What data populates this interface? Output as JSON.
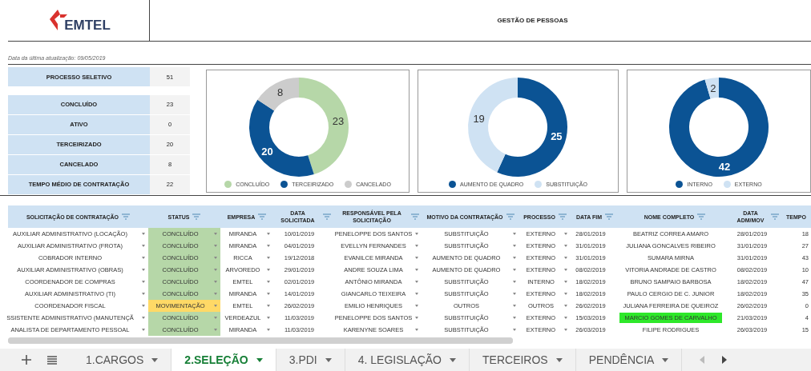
{
  "header": {
    "logo": "EMTEL",
    "title": "GESTÃO DE PESSOAS"
  },
  "last_update": "Data da última atualização: 09/05/2019",
  "summary": {
    "total": {
      "label": "PROCESSO SELETIVO",
      "value": "51"
    },
    "items": [
      {
        "label": "CONCLUÍDO",
        "value": "23"
      },
      {
        "label": "ATIVO",
        "value": "0"
      },
      {
        "label": "TERCEIRIZADO",
        "value": "20"
      },
      {
        "label": "CANCELADO",
        "value": "8"
      },
      {
        "label": "TEMPO MÉDIO DE CONTRATAÇÃO",
        "value": "22"
      }
    ]
  },
  "charts": [
    {
      "chart_data": {
        "type": "donut",
        "categories": [
          "CONCLUÍDO",
          "TERCEIRIZADO",
          "CANCELADO"
        ],
        "values": [
          23,
          20,
          8
        ],
        "colors": [
          "#b6d7a8",
          "#0b5394",
          "#cccccc"
        ],
        "data_labels": true,
        "legend": "bottom"
      }
    },
    {
      "chart_data": {
        "type": "donut",
        "categories": [
          "AUMENTO DE QUADRO",
          "SUBSTITUIÇÃO"
        ],
        "values": [
          25,
          19
        ],
        "colors": [
          "#0b5394",
          "#cfe2f3"
        ],
        "data_labels": true,
        "legend": "bottom"
      }
    },
    {
      "chart_data": {
        "type": "donut",
        "categories": [
          "INTERNO",
          "EXTERNO"
        ],
        "values": [
          42,
          2
        ],
        "colors": [
          "#0b5394",
          "#cfe2f3"
        ],
        "data_labels": true,
        "legend": "bottom"
      }
    }
  ],
  "table": {
    "columns": [
      {
        "label": "SOLICITAÇÃO DE CONTRATAÇÃO",
        "filter": true,
        "dropdown": true
      },
      {
        "label": "STATUS",
        "filter": true,
        "dropdown": true
      },
      {
        "label": "EMPRESA",
        "filter": true,
        "dropdown": true
      },
      {
        "label": "DATA SOLICITADA",
        "filter": true,
        "dropdown": false
      },
      {
        "label": "RESPONSÁVEL PELA SOLICITAÇÃO",
        "filter": true,
        "dropdown": true
      },
      {
        "label": "MOTIVO DA CONTRATAÇÃO",
        "filter": true,
        "dropdown": true
      },
      {
        "label": "PROCESSO",
        "filter": true,
        "dropdown": true
      },
      {
        "label": "DATA FIM",
        "filter": true,
        "dropdown": false
      },
      {
        "label": "NOME COMPLETO",
        "filter": true,
        "dropdown": false
      },
      {
        "label": "DATA ADM/MOV",
        "filter": true,
        "dropdown": false
      },
      {
        "label": "TEMPO",
        "filter": false,
        "dropdown": false
      }
    ],
    "rows": [
      {
        "cells": [
          "AUXILIAR ADMINISTRATIVO (LOCAÇÃO)",
          "CONCLUÍDO",
          "MIRANDA",
          "10/01/2019",
          "PENELOPPE DOS SANTOS",
          "SUBSTITUIÇÃO",
          "EXTERNO",
          "28/01/2019",
          "BEATRIZ CORREA AMARO",
          "28/01/2019",
          "18"
        ],
        "color": "#b6d7a8",
        "highlighted": false
      },
      {
        "cells": [
          "AUXILIAR ADMINISTRATIVO (FROTA)",
          "CONCLUÍDO",
          "MIRANDA",
          "04/01/2019",
          "EVELLYN FERNANDES",
          "SUBSTITUIÇÃO",
          "EXTERNO",
          "31/01/2019",
          "JULIANA GONCALVES RIBEIRO",
          "31/01/2019",
          "27"
        ],
        "color": "#b6d7a8",
        "highlighted": false
      },
      {
        "cells": [
          "COBRADOR INTERNO",
          "CONCLUÍDO",
          "RICCA",
          "19/12/2018",
          "EVANILCE MIRANDA",
          "AUMENTO DE QUADRO",
          "EXTERNO",
          "31/01/2019",
          "SUMARA MIRNA",
          "31/01/2019",
          "43"
        ],
        "color": "#b6d7a8",
        "highlighted": false
      },
      {
        "cells": [
          "AUXILIAR ADMINISTRATIVO  (OBRAS)",
          "CONCLUÍDO",
          "ARVOREDO",
          "29/01/2019",
          "ANDRE SOUZA LIMA",
          "AUMENTO DE QUADRO",
          "EXTERNO",
          "08/02/2019",
          "VITORIA ANDRADE DE CASTRO",
          "08/02/2019",
          "10"
        ],
        "color": "#b6d7a8",
        "highlighted": false
      },
      {
        "cells": [
          "COORDENADOR DE COMPRAS",
          "CONCLUÍDO",
          "EMTEL",
          "02/01/2019",
          "ANTÔNIO MIRANDA",
          "SUBSTITUIÇÃO",
          "INTERNO",
          "18/02/2019",
          "BRUNO SAMPAIO BARBOSA",
          "18/02/2019",
          "47"
        ],
        "color": "#b6d7a8",
        "highlighted": false
      },
      {
        "cells": [
          "AUXILIAR ADMINISTRATIVO (TI)",
          "CONCLUÍDO",
          "MIRANDA",
          "14/01/2019",
          "GIANCARLO TEIXEIRA",
          "SUBSTITUIÇÃO",
          "EXTERNO",
          "18/02/2019",
          "PAULO CERGIO DE C. JUNIOR",
          "18/02/2019",
          "35"
        ],
        "color": "#b6d7a8",
        "highlighted": false
      },
      {
        "cells": [
          "COORDENADOR FISCAL",
          "MOVIMENTAÇÃO",
          "EMTEL",
          "26/02/2019",
          "EMILIO HENRIQUES",
          "OUTROS",
          "OUTROS",
          "26/02/2019",
          "JULIANA FERREIRA DE QUEIROZ",
          "26/02/2019",
          "0"
        ],
        "color": "#ffd966",
        "highlighted": false
      },
      {
        "cells": [
          "SSISTENTE ADMINISTRATIVO (MANUTENÇÃ",
          "CONCLUÍDO",
          "VERDEAZUL",
          "11/03/2019",
          "PENELOPPE DOS SANTOS",
          "SUBSTITUIÇÃO",
          "EXTERNO",
          "15/03/2019",
          "MARCIO GOMES DE CARVALHO",
          "21/03/2019",
          "4"
        ],
        "color": "#b6d7a8",
        "highlighted": true
      },
      {
        "cells": [
          "ANALISTA DE DEPARTAMENTO PESSOAL",
          "CONCLUÍDO",
          "MIRANDA",
          "11/03/2019",
          "KARENYNE SOARES",
          "SUBSTITUIÇÃO",
          "EXTERNO",
          "26/03/2019",
          "FILIPE RODRIGUES",
          "26/03/2019",
          "15"
        ],
        "color": "#b6d7a8",
        "highlighted": false
      }
    ]
  },
  "sheet_tabs": [
    {
      "label": "1.CARGOS",
      "selected": false
    },
    {
      "label": "2.SELEÇÃO",
      "selected": true
    },
    {
      "label": "3.PDI",
      "selected": false
    },
    {
      "label": "4. LEGISLAÇÃO",
      "selected": false
    },
    {
      "label": "TERCEIROS",
      "selected": false
    },
    {
      "label": "PENDÊNCIA",
      "selected": false
    }
  ]
}
